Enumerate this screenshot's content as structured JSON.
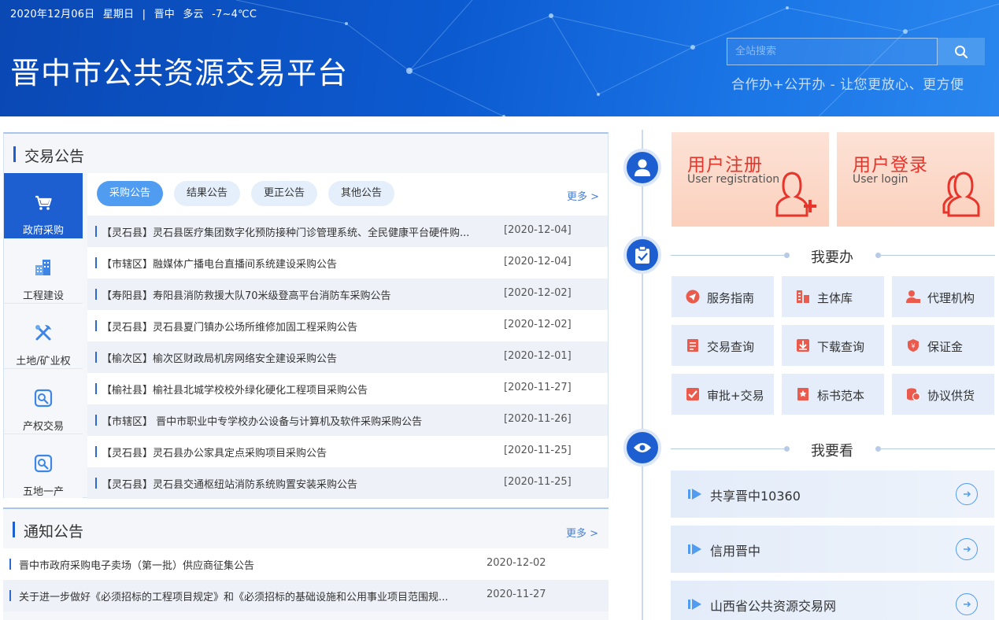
{
  "header": {
    "date": "2020年12月06日",
    "weekday": "星期日",
    "separator": "|",
    "city": "晋中",
    "weather": "多云",
    "temperature": "-7~4℃C",
    "site_title": "晋中市公共资源交易平台",
    "search_placeholder": "全站搜索",
    "slogan": "合作办+公开办 - 让您更放心、更方便"
  },
  "trade": {
    "title": "交易公告",
    "side_tabs": [
      {
        "label": "政府采购",
        "icon": "cart-icon",
        "active": true
      },
      {
        "label": "工程建设",
        "icon": "building-icon",
        "active": false
      },
      {
        "label": "土地/矿业权",
        "icon": "tools-icon",
        "active": false
      },
      {
        "label": "产权交易",
        "icon": "property-icon",
        "active": false
      },
      {
        "label": "五地一产",
        "icon": "land-icon",
        "active": false
      }
    ],
    "pills": [
      "采购公告",
      "结果公告",
      "更正公告",
      "其他公告"
    ],
    "more": "更多 >",
    "rows": [
      {
        "title": "【灵石县】灵石县医疗集团数字化预防接种门诊管理系统、全民健康平台硬件购...",
        "date": "[2020-12-04]"
      },
      {
        "title": "【市辖区】融媒体广播电台直播间系统建设采购公告",
        "date": "[2020-12-04]"
      },
      {
        "title": "【寿阳县】寿阳县消防救援大队70米级登高平台消防车采购公告",
        "date": "[2020-12-02]"
      },
      {
        "title": "【灵石县】灵石县夏门镇办公场所维修加固工程采购公告",
        "date": "[2020-12-02]"
      },
      {
        "title": "【榆次区】榆次区财政局机房网络安全建设采购公告",
        "date": "[2020-12-01]"
      },
      {
        "title": "【榆社县】榆社县北城学校校外绿化硬化工程项目采购公告",
        "date": "[2020-11-27]"
      },
      {
        "title": "【市辖区】 晋中市职业中专学校办公设备与计算机及软件采购采购公告",
        "date": "[2020-11-26]"
      },
      {
        "title": "【灵石县】灵石县办公家具定点采购项目采购公告",
        "date": "[2020-11-25]"
      },
      {
        "title": "【灵石县】灵石县交通枢纽站消防系统购置安装采购公告",
        "date": "[2020-11-25]"
      }
    ]
  },
  "notice": {
    "title": "通知公告",
    "more": "更多 >",
    "rows": [
      {
        "title": "晋中市政府采购电子卖场（第一批）供应商征集公告",
        "date": "2020-12-02"
      },
      {
        "title": "关于进一步做好《必须招标的工程项目规定》和《必须招标的基础设施和公用事业项目范围规...",
        "date": "2020-11-27"
      }
    ]
  },
  "user": {
    "register_cn": "用户注册",
    "register_en": "User registration",
    "login_cn": "用户登录",
    "login_en": "User login"
  },
  "todo": {
    "title": "我要办",
    "items": [
      {
        "label": "服务指南",
        "icon": "guide-icon"
      },
      {
        "label": "主体库",
        "icon": "entity-icon"
      },
      {
        "label": "代理机构",
        "icon": "agent-icon"
      },
      {
        "label": "交易查询",
        "icon": "query-icon"
      },
      {
        "label": "下载查询",
        "icon": "download-icon"
      },
      {
        "label": "保证金",
        "icon": "shield-icon"
      },
      {
        "label": "审批+交易",
        "icon": "approve-icon"
      },
      {
        "label": "标书范本",
        "icon": "template-icon"
      },
      {
        "label": "协议供货",
        "icon": "coins-icon"
      }
    ]
  },
  "watch": {
    "title": "我要看",
    "links": [
      "共享晋中10360",
      "信用晋中",
      "山西省公共资源交易网"
    ]
  },
  "colors": {
    "primary": "#1d5fd1",
    "accent_red": "#e8352b",
    "header_bg": "#0c5ad0"
  }
}
